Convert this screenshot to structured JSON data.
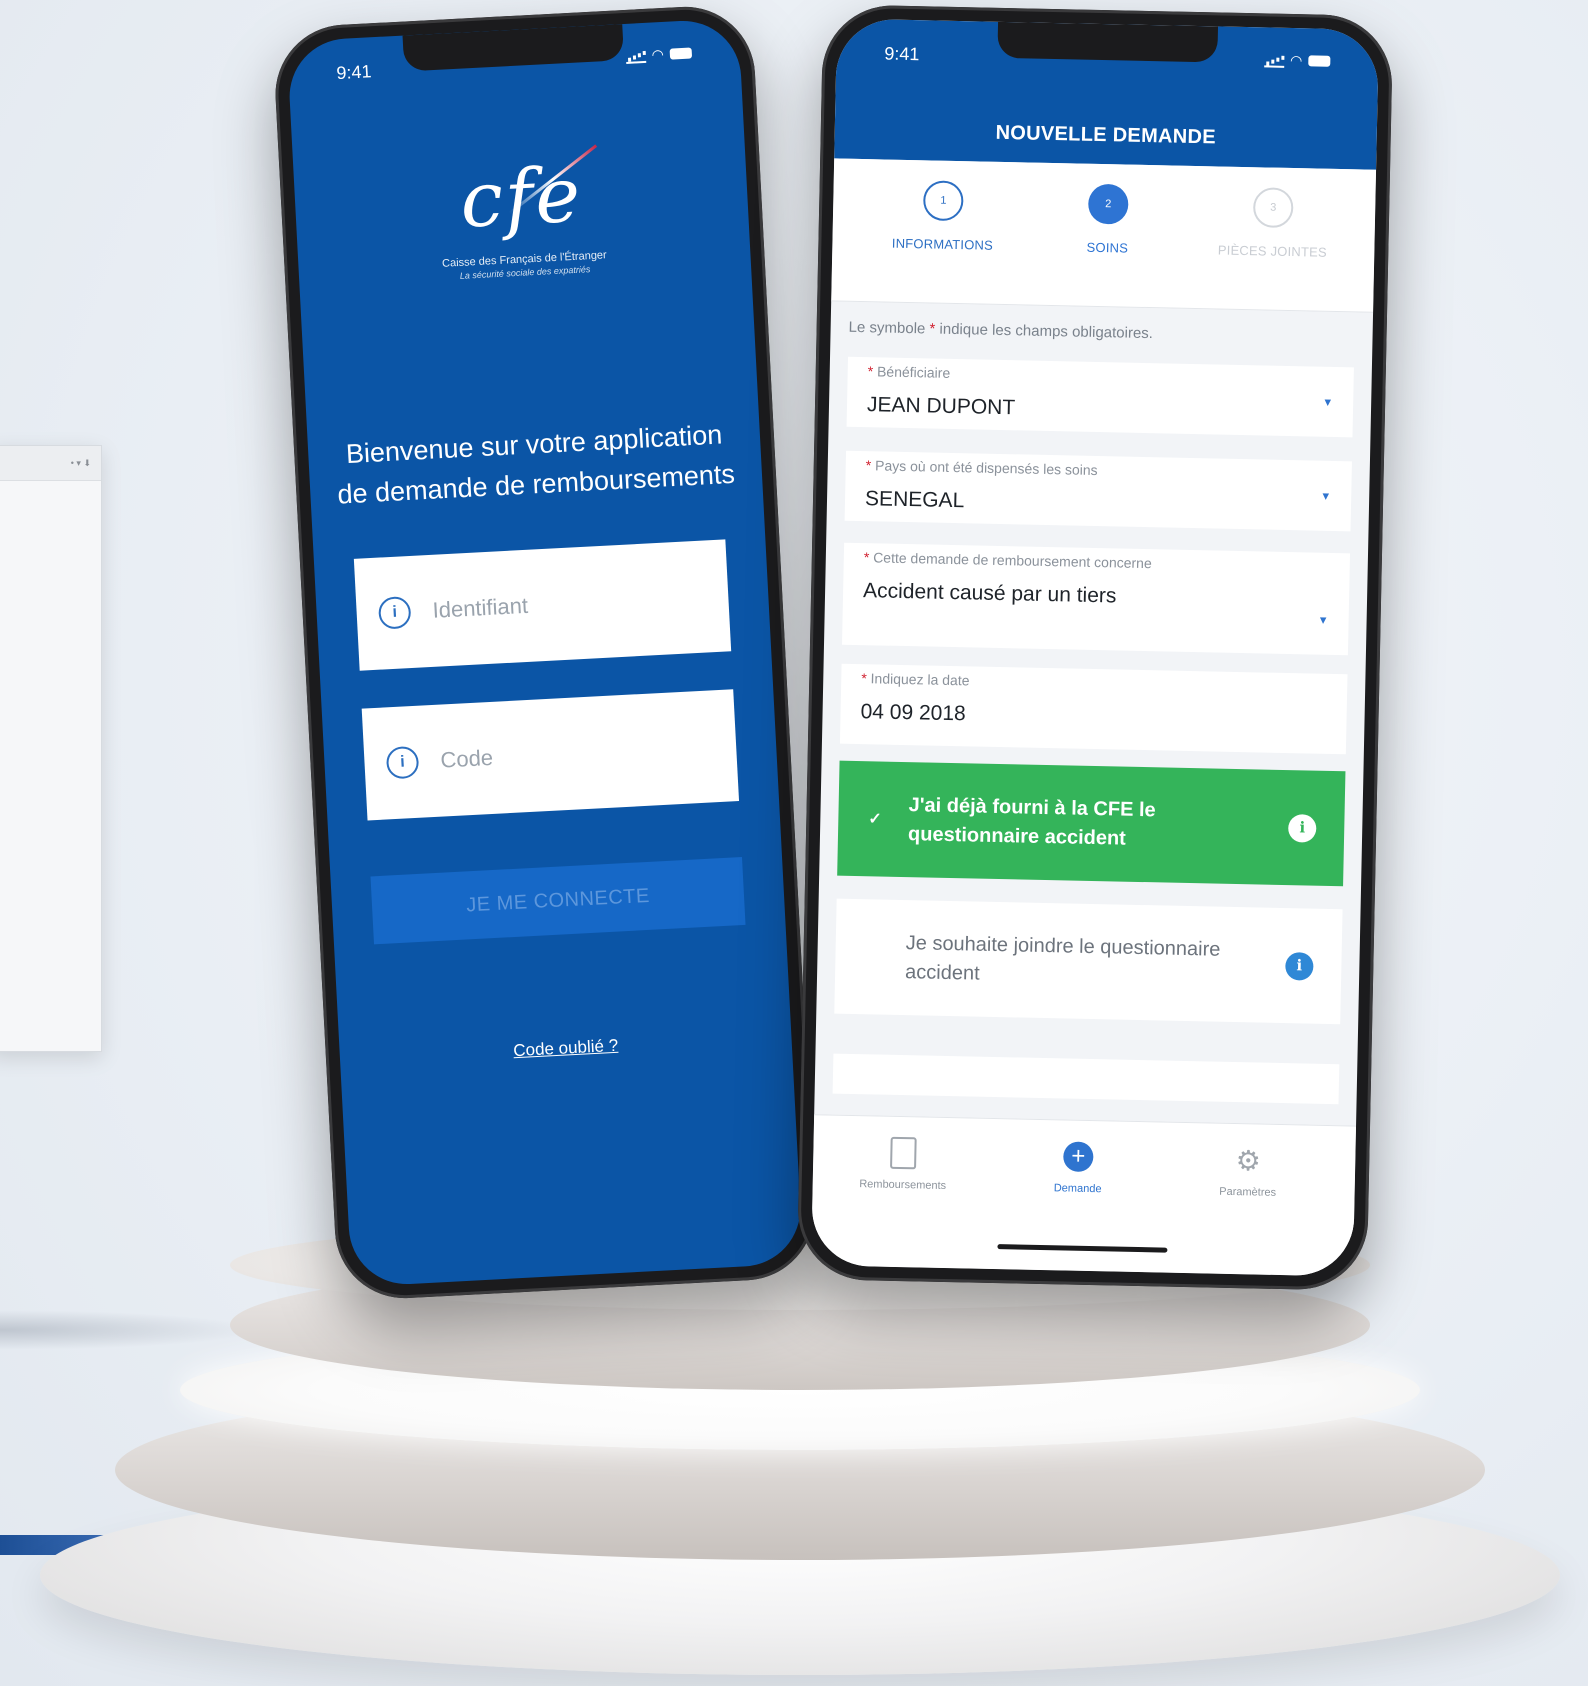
{
  "login": {
    "status_time": "9:41",
    "logo_mark": "cfe",
    "logo_sub1": "Caisse des Français de l'Étranger",
    "logo_sub2": "La sécurité sociale des expatriés",
    "welcome": "Bienvenue sur votre application de demande de remboursements",
    "identifiant_placeholder": "Identifiant",
    "code_placeholder": "Code",
    "connect_label": "JE ME CONNECTE",
    "forgot_label": "Code oublié ?"
  },
  "form": {
    "status_time": "9:41",
    "title": "NOUVELLE DEMANDE",
    "steps": [
      {
        "num": "1",
        "label": "INFORMATIONS"
      },
      {
        "num": "2",
        "label": "SOINS"
      },
      {
        "num": "3",
        "label": "PIÈCES JOINTES"
      }
    ],
    "hint_before": "Le symbole ",
    "hint_star": "*",
    "hint_after": " indique les champs obligatoires.",
    "fields": [
      {
        "label": "Bénéficiaire",
        "value": "JEAN DUPONT"
      },
      {
        "label": "Pays où ont été dispensés les soins",
        "value": "SENEGAL"
      },
      {
        "label": "Cette demande de remboursement concerne",
        "value": "Accident causé par un tiers"
      },
      {
        "label": "Indiquez la date",
        "value": "04 09 2018"
      }
    ],
    "star": "*",
    "option_selected": "J'ai déjà fourni à la CFE le questionnaire accident",
    "option_other": "Je souhaite joindre le questionnaire accident",
    "tabs": [
      {
        "label": "Remboursements",
        "icon": "document-icon"
      },
      {
        "label": "Demande",
        "icon": "plus-circle-icon"
      },
      {
        "label": "Paramètres",
        "icon": "gear-icon"
      }
    ]
  },
  "colors": {
    "brand_blue": "#0b55a6",
    "success_green": "#34b45a",
    "accent_blue": "#2f74cf"
  }
}
